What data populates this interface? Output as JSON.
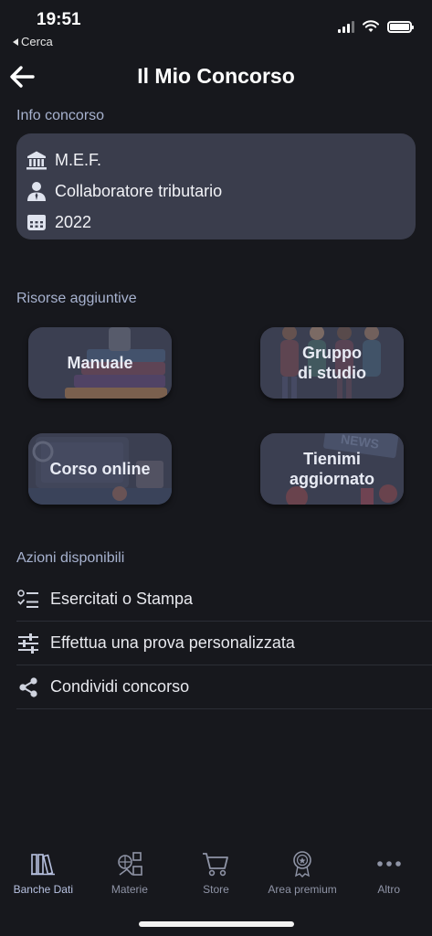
{
  "status_bar": {
    "time": "19:51",
    "back_app": "Cerca"
  },
  "header": {
    "title": "Il Mio Concorso",
    "back_icon": "arrow-left-icon"
  },
  "info_section": {
    "label": "Info concorso",
    "rows": [
      {
        "icon": "bank-icon",
        "text": "M.E.F."
      },
      {
        "icon": "user-tie-icon",
        "text": "Collaboratore tributario"
      },
      {
        "icon": "calendar-icon",
        "text": "2022"
      }
    ]
  },
  "resources_section": {
    "label": "Risorse aggiuntive",
    "tiles": [
      {
        "label": "Manuale"
      },
      {
        "label": "Gruppo\ndi studio"
      },
      {
        "label": "Corso online"
      },
      {
        "label": "Tienimi\naggiornato"
      }
    ]
  },
  "actions_section": {
    "label": "Azioni disponibili",
    "items": [
      {
        "icon": "checklist-icon",
        "text": "Esercitati o Stampa"
      },
      {
        "icon": "sliders-icon",
        "text": "Effettua una prova personalizzata"
      },
      {
        "icon": "share-icon",
        "text": "Condividi concorso"
      }
    ]
  },
  "tab_bar": {
    "active": "Banche Dati",
    "tabs": [
      {
        "icon": "books-icon",
        "label": "Banche Dati"
      },
      {
        "icon": "subjects-icon",
        "label": "Materie"
      },
      {
        "icon": "cart-icon",
        "label": "Store"
      },
      {
        "icon": "badge-icon",
        "label": "Area premium"
      },
      {
        "icon": "more-icon",
        "label": "Altro"
      }
    ]
  },
  "colors": {
    "background": "#17181d",
    "card": "#3a3d4c",
    "section_label": "#a7b2cf",
    "accent": "#b7c1e0"
  }
}
